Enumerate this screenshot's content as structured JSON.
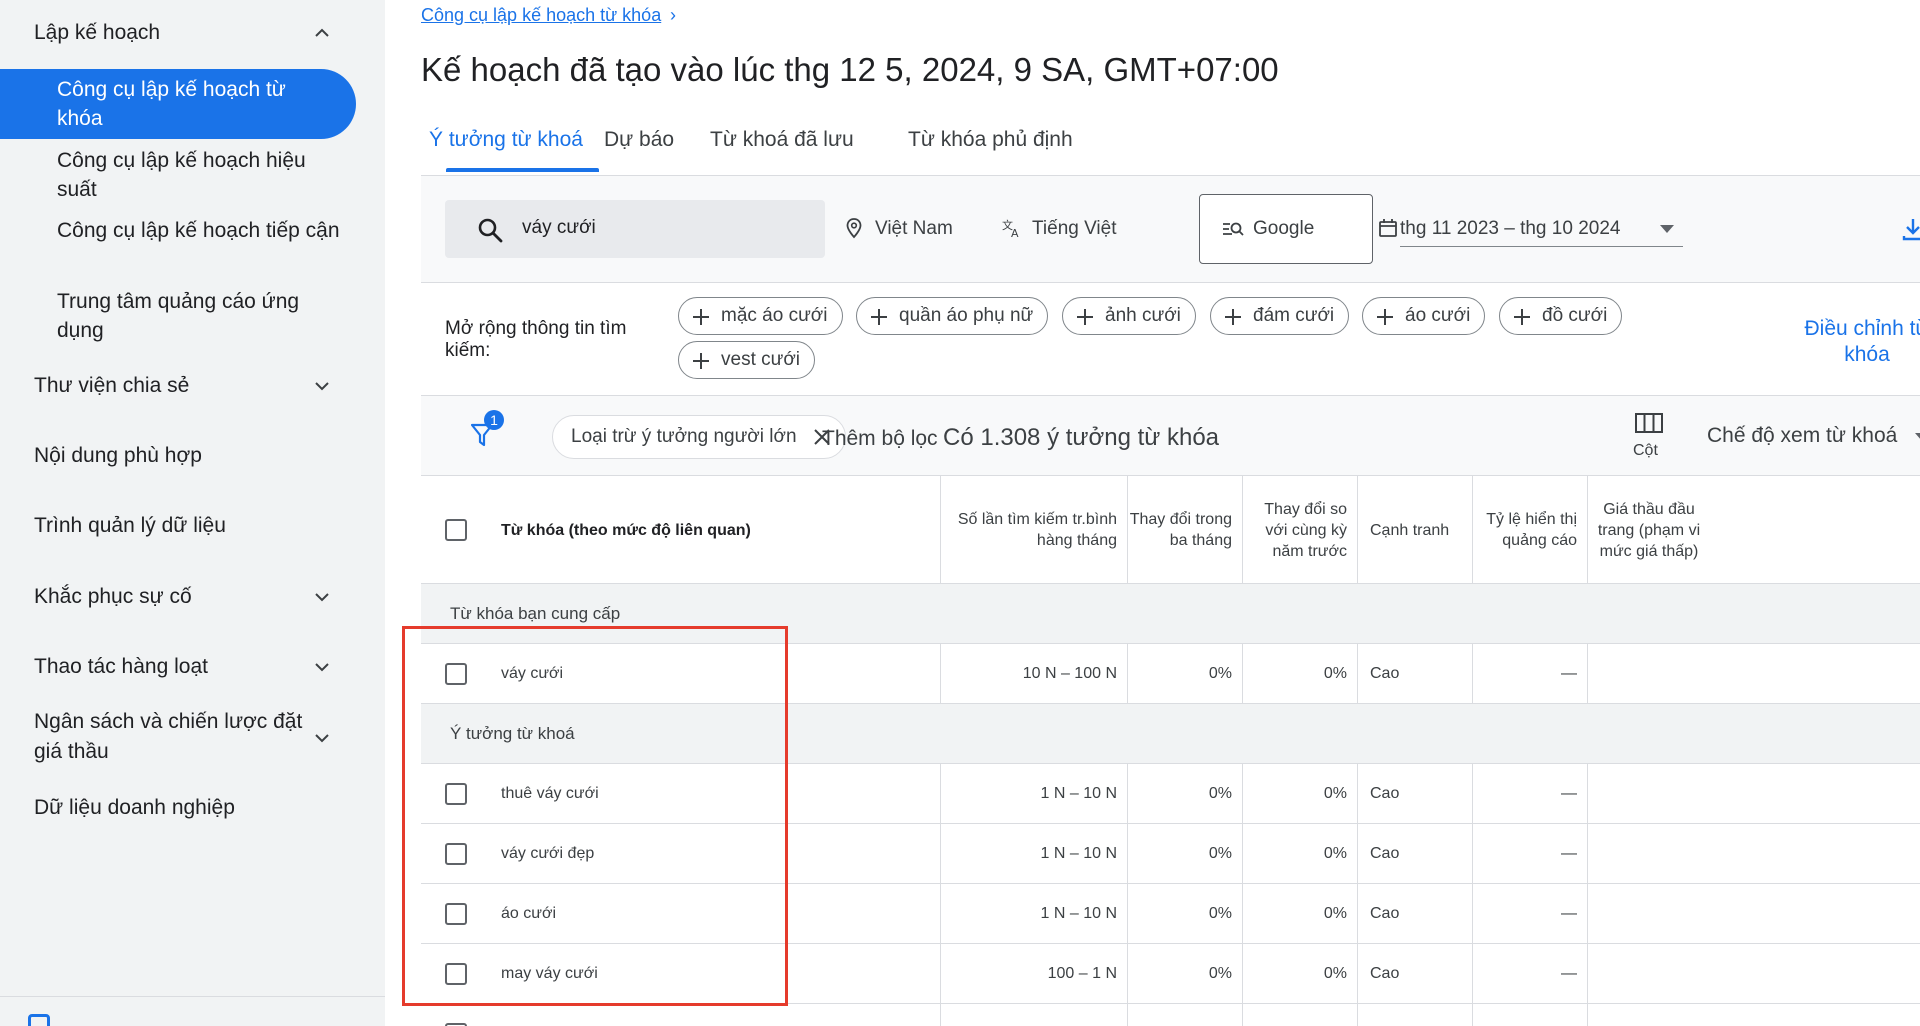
{
  "sidebar": {
    "sections": [
      {
        "label": "Lập kế hoạch",
        "chevron": "chevron-up"
      },
      {
        "label": "Thư viện chia sẻ",
        "chevron": "chevron-down"
      },
      {
        "label": "Nội dung phù hợp",
        "chevron": ""
      },
      {
        "label": "Trình quản lý dữ liệu",
        "chevron": ""
      },
      {
        "label": "Khắc phục sự cố",
        "chevron": "chevron-down"
      },
      {
        "label": "Thao tác hàng loạt",
        "chevron": "chevron-down"
      },
      {
        "label": "Ngân sách và chiến lược đặt giá thầu",
        "chevron": "chevron-down"
      },
      {
        "label": "Dữ liệu doanh nghiệp",
        "chevron": ""
      }
    ],
    "sub_items": [
      {
        "label": "Công cụ lập kế hoạch từ khóa",
        "active": true
      },
      {
        "label": "Công cụ lập kế hoạch hiệu suất",
        "active": false
      },
      {
        "label": "Công cụ lập kế hoạch tiếp cận",
        "active": false
      },
      {
        "label": "Trung tâm quảng cáo ứng dụng",
        "active": false
      }
    ]
  },
  "breadcrumb": {
    "label": "Công cụ lập kế hoạch từ khóa",
    "chevron": "›"
  },
  "page_title": "Kế hoạch đã tạo vào lúc thg 12 5, 2024, 9 SA, GMT+07:00",
  "tabs": [
    {
      "label": "Ý tưởng từ khoá",
      "active": true
    },
    {
      "label": "Dự báo",
      "active": false
    },
    {
      "label": "Từ khoá đã lưu",
      "active": false
    },
    {
      "label": "Từ khóa phủ định",
      "active": false
    }
  ],
  "toolbar": {
    "search_value": "váy cưới",
    "location": "Việt Nam",
    "language": "Tiếng Việt",
    "engine": "Google",
    "date_range": "thg 11 2023 – thg 10 2024"
  },
  "expand": {
    "label": "Mở rộng thông tin tìm kiếm:",
    "chips": [
      "mặc áo cưới",
      "quần áo phụ nữ",
      "ảnh cưới",
      "đám cưới",
      "áo cưới",
      "đồ cưới",
      "vest cưới"
    ],
    "adjust_link": "Điều chỉnh từ khóa"
  },
  "filters": {
    "badge_count": "1",
    "active_filter": "Loại trừ ý tưởng người lớn",
    "add_filter": "Thêm bộ lọc",
    "count_text": "Có 1.308 ý tưởng từ khóa",
    "columns_label": "Cột",
    "view_mode": "Chế độ xem từ khoá"
  },
  "table": {
    "headers": [
      "Từ khóa (theo mức độ liên quan)",
      "Số lần tìm kiếm tr.bình hàng tháng",
      "Thay đổi trong ba tháng",
      "Thay đổi so với cùng kỳ năm trước",
      "Cạnh tranh",
      "Tỷ lệ hiển thị quảng cáo",
      "Giá thầu đầu trang (phạm vi mức giá thấp)"
    ],
    "groups": [
      {
        "label": "Từ khóa bạn cung cấp",
        "rows": [
          {
            "keyword": "váy cưới",
            "searches": "10 N – 100 N",
            "three_month": "0%",
            "yoy": "0%",
            "competition": "Cao",
            "impression_share": "—"
          }
        ]
      },
      {
        "label": "Ý tưởng từ khoá",
        "rows": [
          {
            "keyword": "thuê váy cưới",
            "searches": "1 N – 10 N",
            "three_month": "0%",
            "yoy": "0%",
            "competition": "Cao",
            "impression_share": "—"
          },
          {
            "keyword": "váy cưới đẹp",
            "searches": "1 N – 10 N",
            "three_month": "0%",
            "yoy": "0%",
            "competition": "Cao",
            "impression_share": "—"
          },
          {
            "keyword": "áo cưới",
            "searches": "1 N – 10 N",
            "three_month": "0%",
            "yoy": "0%",
            "competition": "Cao",
            "impression_share": "—"
          },
          {
            "keyword": "may váy cưới",
            "searches": "100 – 1 N",
            "three_month": "0%",
            "yoy": "0%",
            "competition": "Cao",
            "impression_share": "—"
          }
        ]
      }
    ]
  },
  "colors": {
    "accent": "#1a73e8",
    "highlight": "#e53b2c"
  }
}
